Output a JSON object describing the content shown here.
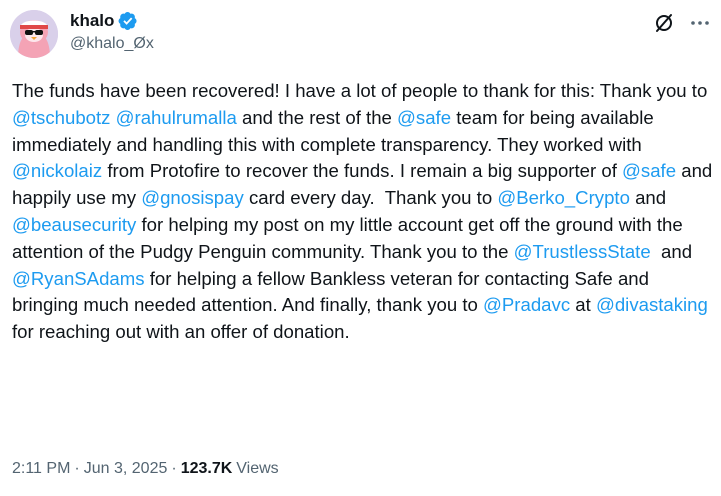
{
  "author": {
    "display_name": "khalo",
    "handle": "@khalo_Øx",
    "verified": true
  },
  "colors": {
    "link": "#1d9bf0",
    "text": "#0f1419",
    "muted": "#536471",
    "verified_badge": "#1d9bf0"
  },
  "icons": {
    "grok": "grok-icon",
    "more": "more-icon",
    "verified": "verified-badge-icon"
  },
  "tweet": {
    "segments": [
      {
        "type": "text",
        "value": "The funds have been recovered! I have a lot of people to thank for this: Thank you to "
      },
      {
        "type": "mention",
        "value": "@tschubotz"
      },
      {
        "type": "text",
        "value": " "
      },
      {
        "type": "mention",
        "value": "@rahulrumalla"
      },
      {
        "type": "text",
        "value": " and the rest of the "
      },
      {
        "type": "mention",
        "value": "@safe"
      },
      {
        "type": "text",
        "value": " team for being available immediately and handling this with complete transparency. They worked with "
      },
      {
        "type": "mention",
        "value": "@nickolaiz"
      },
      {
        "type": "text",
        "value": " from Protofire to recover the funds. I remain a big supporter of "
      },
      {
        "type": "mention",
        "value": "@safe"
      },
      {
        "type": "text",
        "value": " and happily use my "
      },
      {
        "type": "mention",
        "value": "@gnosispay"
      },
      {
        "type": "text",
        "value": " card every day.  Thank you to "
      },
      {
        "type": "mention",
        "value": "@Berko_Crypto"
      },
      {
        "type": "text",
        "value": " and "
      },
      {
        "type": "mention",
        "value": "@beausecurity"
      },
      {
        "type": "text",
        "value": " for helping my post on my little account get off the ground with the attention of the Pudgy Penguin community. Thank you to the "
      },
      {
        "type": "mention",
        "value": "@TrustlessState"
      },
      {
        "type": "text",
        "value": "  and "
      },
      {
        "type": "mention",
        "value": "@RyanSAdams"
      },
      {
        "type": "text",
        "value": " for helping a fellow Bankless veteran for contacting Safe and bringing much needed attention. And finally, thank you to "
      },
      {
        "type": "mention",
        "value": "@Pradavc"
      },
      {
        "type": "text",
        "value": " at "
      },
      {
        "type": "mention",
        "value": "@divastaking"
      },
      {
        "type": "text",
        "value": " for reaching out with an offer of donation."
      }
    ]
  },
  "meta": {
    "time": "2:11 PM",
    "separator": "·",
    "date": "Jun 3, 2025",
    "views_count": "123.7K",
    "views_label": "Views"
  }
}
